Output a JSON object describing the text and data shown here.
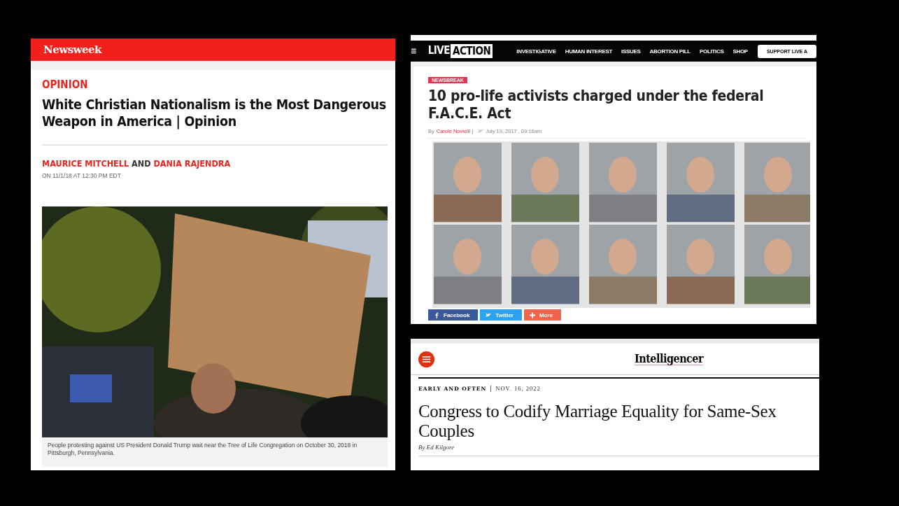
{
  "panels": [
    {
      "kind": "newsweek",
      "logo": "Newsweek",
      "section": "OPINION",
      "headline": "White Christian Nationalism is the Most Dangerous Weapon in America | Opinion",
      "authors": [
        "MAURICE MITCHELL",
        "DANIA RAJENDRA"
      ],
      "author_joiner": "AND",
      "timestamp": "ON 11/1/18 AT 12:30 PM EDT",
      "photo": {
        "kind": "picture"
      },
      "caption": "People protesting against US President Donald Trump wait near the Tree of Life Congregation on October 30, 2018 in Pittsburgh, Pennsylvania."
    },
    {
      "kind": "liveaction",
      "logo": [
        "LIVE",
        "ACTION"
      ],
      "nav": [
        "INVESTIGATIVE",
        "HUMAN INTEREST",
        "ISSUES",
        "ABORTION PILL",
        "POLITICS",
        "SHOP"
      ],
      "support_button": "SUPPORT LIVE A",
      "tag": "NEWSBREAK",
      "headline": "10 pro-life activists charged under the federal F.A.C.E. Act",
      "by": "By",
      "author": "Carole Novielli |",
      "date": "July 19, 2017 , 09:16am",
      "photo": {
        "kind": "picture"
      },
      "share": [
        {
          "label": "Facebook",
          "color": "#3b5998",
          "kind": "facebook"
        },
        {
          "label": "Twitter",
          "color": "#2aa3ef",
          "kind": "twitter"
        },
        {
          "label": "More",
          "color": "#f0644b",
          "kind": "more"
        }
      ]
    },
    {
      "kind": "intelligencer",
      "logo": "Intelligencer",
      "rubric": "EARLY AND OFTEN",
      "date": "NOV. 16, 2022",
      "headline": "Congress to Codify Marriage Equality for Same-Sex Couples",
      "byline": "By Ed Kilgore"
    }
  ]
}
